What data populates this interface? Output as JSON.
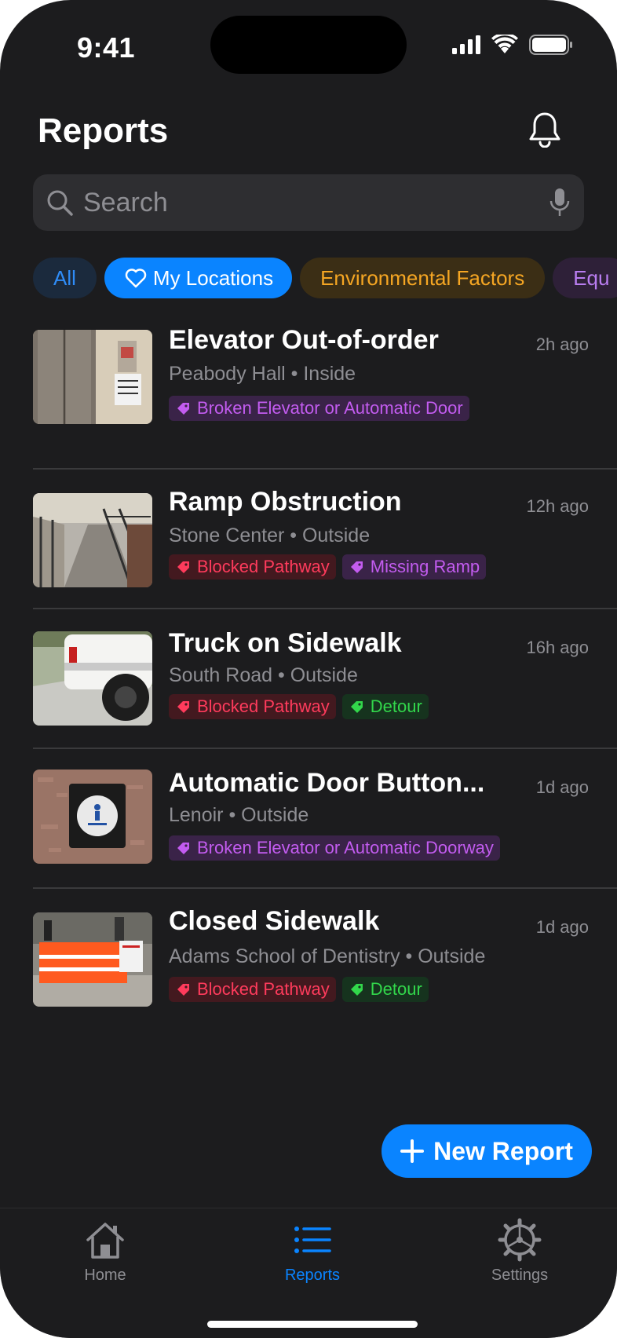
{
  "status_bar": {
    "time": "9:41"
  },
  "header": {
    "title": "Reports"
  },
  "search": {
    "placeholder": "Search"
  },
  "filters": [
    {
      "label": "All",
      "selected": false,
      "color": "#2f8cf7"
    },
    {
      "label": "My Locations",
      "selected": true,
      "color": "#0a84ff"
    },
    {
      "label": "Environmental Factors",
      "selected": false,
      "color": "#f5a623"
    },
    {
      "label": "Equ",
      "selected": false,
      "color": "#b97df0"
    }
  ],
  "reports": [
    {
      "title": "Elevator Out-of-order",
      "time": "2h ago",
      "location": "Peabody Hall • Inside",
      "tags": [
        {
          "label": "Broken Elevator or Automatic Door",
          "color": "purple"
        }
      ]
    },
    {
      "title": "Ramp Obstruction",
      "time": "12h ago",
      "location": "Stone Center • Outside",
      "tags": [
        {
          "label": "Blocked Pathway",
          "color": "red"
        },
        {
          "label": "Missing Ramp",
          "color": "purple"
        }
      ]
    },
    {
      "title": "Truck on Sidewalk",
      "time": "16h ago",
      "location": "South Road • Outside",
      "tags": [
        {
          "label": "Blocked Pathway",
          "color": "red"
        },
        {
          "label": "Detour",
          "color": "green"
        }
      ]
    },
    {
      "title": "Automatic Door Button...",
      "time": "1d ago",
      "location": "Lenoir • Outside",
      "tags": [
        {
          "label": "Broken Elevator or Automatic Doorway",
          "color": "purple"
        }
      ]
    },
    {
      "title": "Closed Sidewalk",
      "time": "1d ago",
      "location": "Adams School of Dentistry • Outside",
      "tags": [
        {
          "label": "Blocked Pathway",
          "color": "red"
        },
        {
          "label": "Detour",
          "color": "green"
        }
      ]
    }
  ],
  "fab": {
    "label": "New Report"
  },
  "tabbar": {
    "home": "Home",
    "reports": "Reports",
    "settings": "Settings",
    "active": "Reports"
  },
  "colors": {
    "accent": "#0a84ff",
    "background": "#1c1c1e",
    "secondary_text": "#8e8e93"
  }
}
